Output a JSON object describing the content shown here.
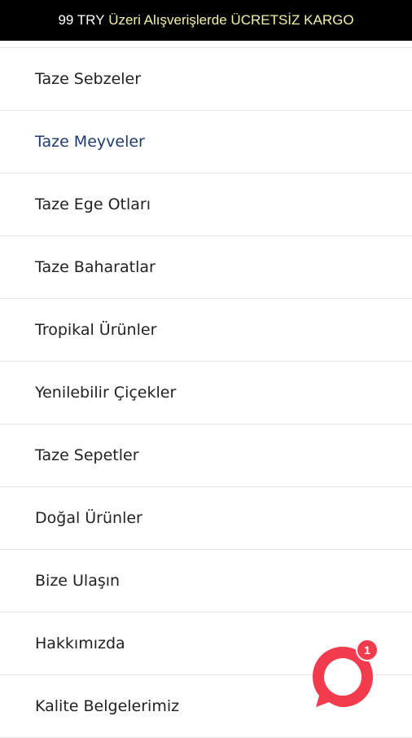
{
  "banner": {
    "part1": "99 TRY",
    "part2": "Üzeri Alışverişlerde ÜCRETSİZ KARGO",
    "color_white": "#ffffff",
    "color_yellow": "#f5f0a8"
  },
  "menu": {
    "items": [
      {
        "label": "Taze Sebzeler"
      },
      {
        "label": "Taze Meyveler"
      },
      {
        "label": "Taze Ege Otları"
      },
      {
        "label": "Taze Baharatlar"
      },
      {
        "label": "Tropikal Ürünler"
      },
      {
        "label": "Yenilebilir Çiçekler"
      },
      {
        "label": "Taze Sepetler"
      },
      {
        "label": "Doğal Ürünler"
      },
      {
        "label": "Bize Ulaşın"
      },
      {
        "label": "Hakkımızda"
      },
      {
        "label": "Kalite Belgelerimiz"
      }
    ],
    "active_color": "#1f3a6e"
  },
  "chat": {
    "icon": "chat-bubble-icon",
    "badge_count": "1",
    "color": "#f23c4e"
  }
}
